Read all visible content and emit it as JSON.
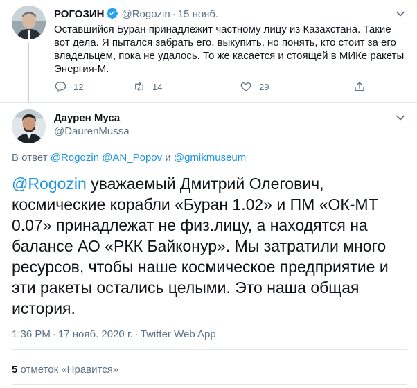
{
  "tweet1": {
    "name": "РОГОЗИН",
    "handle": "@Rogozin",
    "separator": "·",
    "date": "15 нояб.",
    "text": "Оставшийся Буран принадлежит частному лицу из Казахстана. Такие вот дела. Я пытался забрать его, выкупить, но понять, кто стоит за его владельцем, пока не удалось.  То же касается и стоящей в МИКе ракеты Энергия-М.",
    "actions": {
      "reply_count": "12",
      "retweet_count": "14",
      "like_count": "29"
    }
  },
  "tweet2": {
    "name": "Даурен Муса",
    "handle": "@DaurenMussa",
    "reply_prefix": "В ответ ",
    "reply_mention1": "@Rogozin",
    "reply_mention2": "@AN_Popov",
    "reply_and": " и ",
    "reply_mention3": "@gmikmuseum",
    "mention": "@Rogozin",
    "text": " уважаемый Дмитрий Олегович, космические корабли «Буран 1.02» и ПМ «ОК-МТ 0.07» принадлежат не физ.лицу, а находятся на балансе АО «РКК Байконур». Мы затратили много ресурсов, чтобы наше космическое предприятие и эти ракеты остались целыми. Это наша общая история.",
    "time": "1:36 PM",
    "separator": "·",
    "date": "17 нояб. 2020 г.",
    "client": "Twitter Web App",
    "likes_count": "5",
    "likes_label": " отметок «Нравится»"
  },
  "colors": {
    "link": "#1b95e0",
    "muted": "#5b7083",
    "text": "#0f1419",
    "border": "#e1e8ed",
    "verified": "#1da1f2"
  },
  "icons": [
    "verified-badge-icon",
    "chevron-down-icon",
    "reply-icon",
    "retweet-icon",
    "heart-icon",
    "share-icon"
  ]
}
